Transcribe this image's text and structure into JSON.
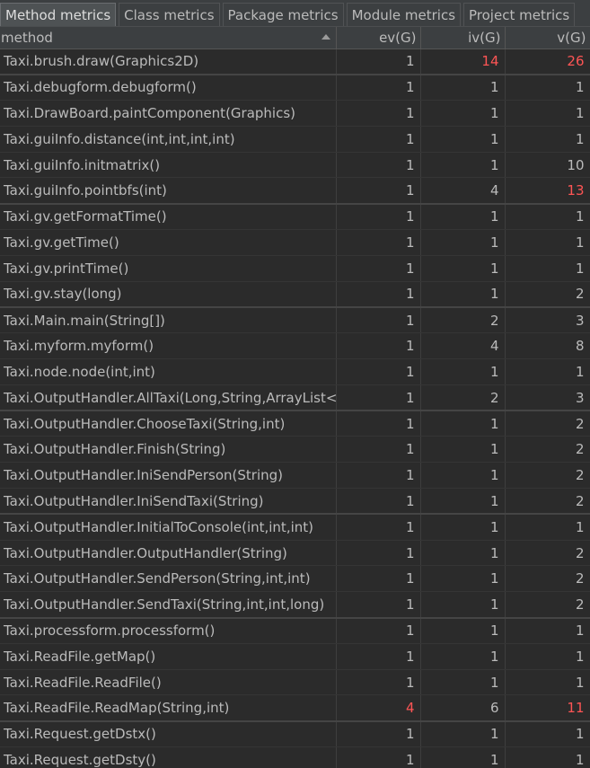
{
  "tabs": [
    {
      "label": "Method metrics",
      "active": true
    },
    {
      "label": "Class metrics",
      "active": false
    },
    {
      "label": "Package metrics",
      "active": false
    },
    {
      "label": "Module metrics",
      "active": false
    },
    {
      "label": "Project metrics",
      "active": false
    }
  ],
  "columns": {
    "method": "method",
    "ev": "ev(G)",
    "iv": "iv(G)",
    "v": "v(G)"
  },
  "colors": {
    "warning": "#ff5555",
    "normal": "#bbbbbb"
  },
  "rows": [
    {
      "method": "Taxi.brush.draw(Graphics2D)",
      "ev": "1",
      "iv": "14",
      "v": "26",
      "hot": [
        "iv",
        "v"
      ]
    },
    {
      "method": "Taxi.debugform.debugform()",
      "ev": "1",
      "iv": "1",
      "v": "1",
      "hot": []
    },
    {
      "method": "Taxi.DrawBoard.paintComponent(Graphics)",
      "ev": "1",
      "iv": "1",
      "v": "1",
      "hot": []
    },
    {
      "method": "Taxi.guiInfo.distance(int,int,int,int)",
      "ev": "1",
      "iv": "1",
      "v": "1",
      "hot": []
    },
    {
      "method": "Taxi.guiInfo.initmatrix()",
      "ev": "1",
      "iv": "1",
      "v": "10",
      "hot": []
    },
    {
      "method": "Taxi.guiInfo.pointbfs(int)",
      "ev": "1",
      "iv": "4",
      "v": "13",
      "hot": [
        "v"
      ]
    },
    {
      "method": "Taxi.gv.getFormatTime()",
      "ev": "1",
      "iv": "1",
      "v": "1",
      "hot": []
    },
    {
      "method": "Taxi.gv.getTime()",
      "ev": "1",
      "iv": "1",
      "v": "1",
      "hot": []
    },
    {
      "method": "Taxi.gv.printTime()",
      "ev": "1",
      "iv": "1",
      "v": "1",
      "hot": []
    },
    {
      "method": "Taxi.gv.stay(long)",
      "ev": "1",
      "iv": "1",
      "v": "2",
      "hot": []
    },
    {
      "method": "Taxi.Main.main(String[])",
      "ev": "1",
      "iv": "2",
      "v": "3",
      "hot": []
    },
    {
      "method": "Taxi.myform.myform()",
      "ev": "1",
      "iv": "4",
      "v": "8",
      "hot": []
    },
    {
      "method": "Taxi.node.node(int,int)",
      "ev": "1",
      "iv": "1",
      "v": "1",
      "hot": []
    },
    {
      "method": "Taxi.OutputHandler.AllTaxi(Long,String,ArrayList<I",
      "ev": "1",
      "iv": "2",
      "v": "3",
      "hot": []
    },
    {
      "method": "Taxi.OutputHandler.ChooseTaxi(String,int)",
      "ev": "1",
      "iv": "1",
      "v": "2",
      "hot": []
    },
    {
      "method": "Taxi.OutputHandler.Finish(String)",
      "ev": "1",
      "iv": "1",
      "v": "2",
      "hot": []
    },
    {
      "method": "Taxi.OutputHandler.IniSendPerson(String)",
      "ev": "1",
      "iv": "1",
      "v": "2",
      "hot": []
    },
    {
      "method": "Taxi.OutputHandler.IniSendTaxi(String)",
      "ev": "1",
      "iv": "1",
      "v": "2",
      "hot": []
    },
    {
      "method": "Taxi.OutputHandler.InitialToConsole(int,int,int)",
      "ev": "1",
      "iv": "1",
      "v": "1",
      "hot": []
    },
    {
      "method": "Taxi.OutputHandler.OutputHandler(String)",
      "ev": "1",
      "iv": "1",
      "v": "2",
      "hot": []
    },
    {
      "method": "Taxi.OutputHandler.SendPerson(String,int,int)",
      "ev": "1",
      "iv": "1",
      "v": "2",
      "hot": []
    },
    {
      "method": "Taxi.OutputHandler.SendTaxi(String,int,int,long)",
      "ev": "1",
      "iv": "1",
      "v": "2",
      "hot": []
    },
    {
      "method": "Taxi.processform.processform()",
      "ev": "1",
      "iv": "1",
      "v": "1",
      "hot": []
    },
    {
      "method": "Taxi.ReadFile.getMap()",
      "ev": "1",
      "iv": "1",
      "v": "1",
      "hot": []
    },
    {
      "method": "Taxi.ReadFile.ReadFile()",
      "ev": "1",
      "iv": "1",
      "v": "1",
      "hot": []
    },
    {
      "method": "Taxi.ReadFile.ReadMap(String,int)",
      "ev": "4",
      "iv": "6",
      "v": "11",
      "hot": [
        "ev",
        "v"
      ]
    },
    {
      "method": "Taxi.Request.getDstx()",
      "ev": "1",
      "iv": "1",
      "v": "1",
      "hot": []
    },
    {
      "method": "Taxi.Request.getDsty()",
      "ev": "1",
      "iv": "1",
      "v": "1",
      "hot": []
    }
  ]
}
